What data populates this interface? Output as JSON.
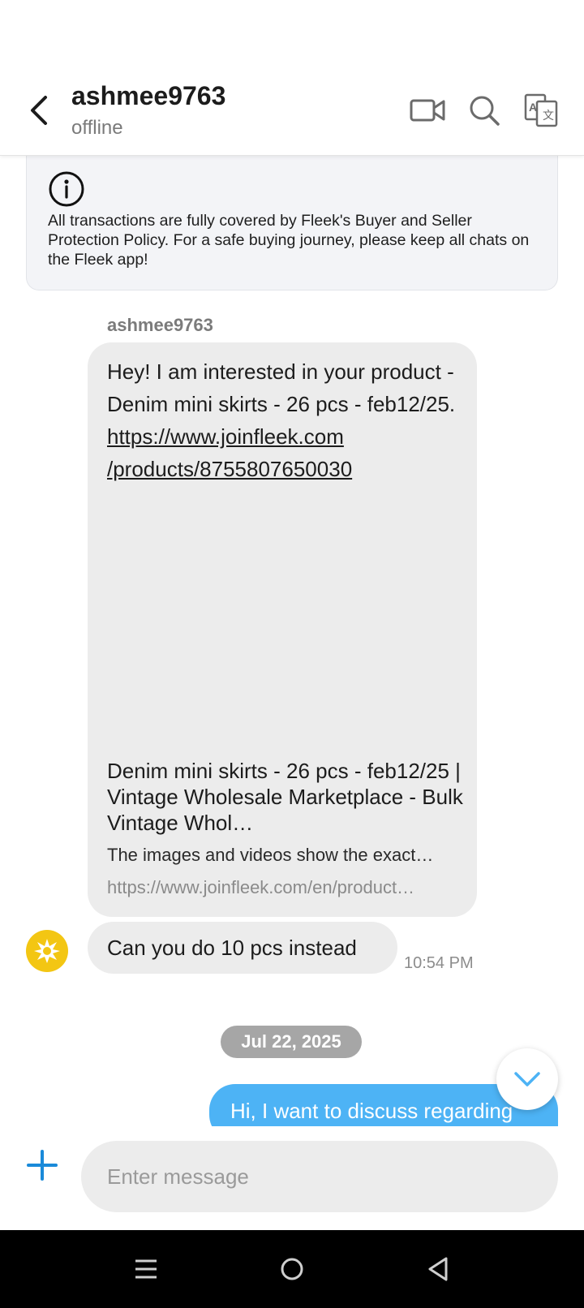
{
  "header": {
    "username": "ashmee9763",
    "status": "offline",
    "icons": [
      "back-arrow-icon",
      "video-call-icon",
      "search-icon",
      "translate-icon"
    ]
  },
  "notice": {
    "icon": "info-icon",
    "text": "All transactions are fully covered by Fleek's Buyer and Seller Protection Policy. For a safe buying journey, please keep all chats on the Fleek app!"
  },
  "messages": {
    "sender_name": "ashmee9763",
    "first": {
      "text": "Hey! I am interested in your product - Denim mini skirts - 26 pcs - feb12/25.",
      "link_line1": "https://www.joinfleek.com",
      "link_line2": "/products/8755807650030",
      "preview_title": "Denim mini skirts - 26 pcs - feb12/25 | Vintage Wholesale Marketplace - Bulk Vintage Whol…",
      "preview_desc": "The images and videos show the exact…",
      "preview_url": "https://www.joinfleek.com/en/product…"
    },
    "second": {
      "text": "Can you do 10 pcs instead",
      "time": "10:54 PM"
    },
    "date_separator": "Jul 22, 2025",
    "outgoing": {
      "text": "Hi, I want to discuss regarding"
    }
  },
  "composer": {
    "placeholder": "Enter message"
  },
  "colors": {
    "accent": "#4db3f5",
    "add_button": "#1a8ad9",
    "incoming_bubble": "#ececec",
    "avatar": "#f3c613",
    "date_chip": "#a6a6a6"
  }
}
